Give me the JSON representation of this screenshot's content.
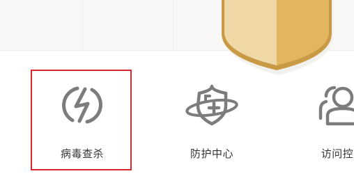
{
  "header": {
    "shield_colors": {
      "light_face": "#efd7a6",
      "dark_face": "#e2b55f",
      "rim": "#c99a45"
    }
  },
  "features": [
    {
      "label": "病毒查杀",
      "icon": "lightning-circle-icon",
      "selected": true
    },
    {
      "label": "防护中心",
      "icon": "shield-orbit-icon",
      "selected": false
    },
    {
      "label": "访问控",
      "icon": "user-group-icon",
      "selected": false
    }
  ],
  "colors": {
    "icon_gray": "#7c7c7c",
    "label_text": "#333333",
    "selection_outline": "#d9262c",
    "top_band": "#f8f7f5"
  }
}
